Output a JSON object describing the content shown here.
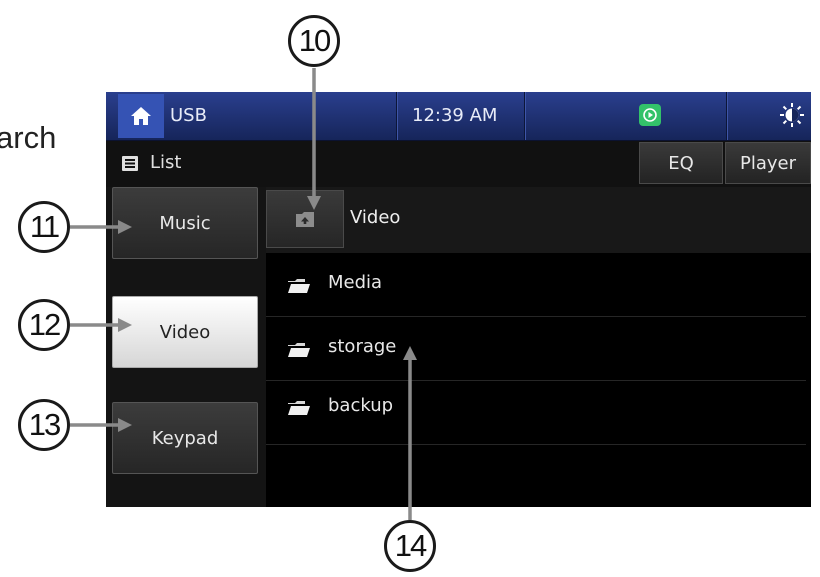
{
  "left_fragment_text": "arch",
  "status_bar": {
    "source_label": "USB",
    "clock": "12:39 AM",
    "home_icon": "home-icon",
    "carplay_icon": "carplay-icon",
    "brightness_icon": "brightness-icon"
  },
  "sub_bar": {
    "list_label": "List",
    "eq_label": "EQ",
    "player_label": "Player"
  },
  "sidebar": {
    "items": [
      {
        "label": "Music",
        "selected": false
      },
      {
        "label": "Video",
        "selected": true
      },
      {
        "label": "Keypad",
        "selected": false
      }
    ]
  },
  "browser": {
    "current_folder": "Video",
    "up_icon": "folder-up-icon",
    "folders": [
      {
        "name": "Media"
      },
      {
        "name": "storage"
      },
      {
        "name": "backup"
      }
    ]
  },
  "callouts": [
    "10",
    "11",
    "12",
    "13",
    "14"
  ],
  "colors": {
    "status_bar": "#1f3272",
    "home_button": "#3553b4",
    "carplay_green": "#33c26a",
    "selected_button": "#f2f2f2"
  }
}
